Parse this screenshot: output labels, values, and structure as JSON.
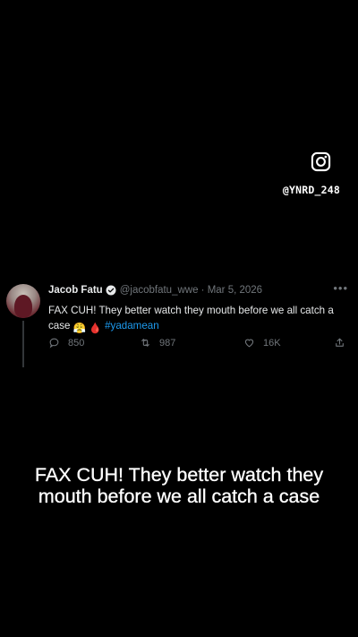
{
  "watermark": {
    "icon": "instagram-icon",
    "handle": "@YNRD_248"
  },
  "tweet": {
    "author_name": "Jacob Fatu",
    "verified_icon": "verified-badge-icon",
    "meta": "@jacobfatu_wwe · Mar 5, 2026",
    "more_icon": "more-options-icon",
    "text_main": "FAX CUH! They better watch they mouth before we all catch a case",
    "emoji_1": "😤",
    "emoji_2": "🩸",
    "hashtag": "#yadamean",
    "replies": "850",
    "retweets": "987",
    "likes": "16K",
    "colors": {
      "hashtag": "#1d9bf0",
      "muted": "#71767b",
      "verified": "#1d9bf0"
    }
  },
  "caption": "FAX CUH! They better watch they mouth before we all catch a case"
}
